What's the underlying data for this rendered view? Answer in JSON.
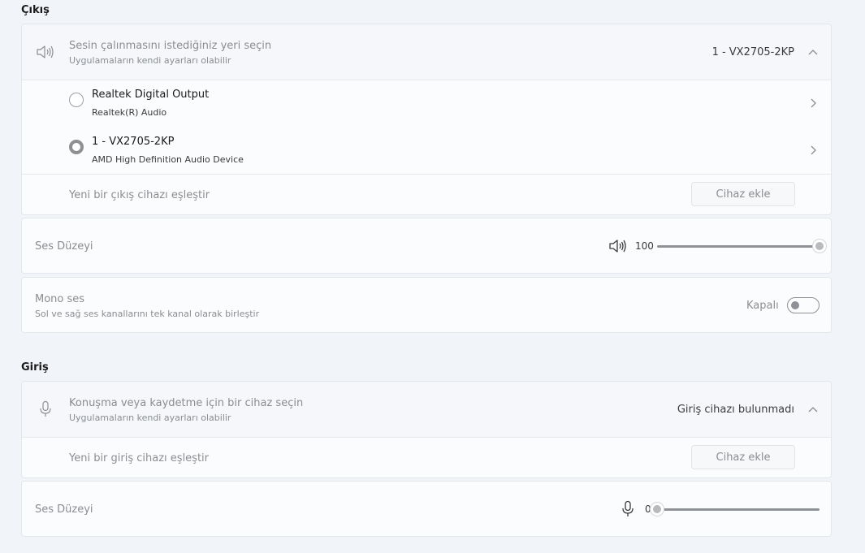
{
  "output": {
    "section_title": "Çıkış",
    "device_picker": {
      "title": "Sesin çalınmasını istediğiniz yeri seçin",
      "subtitle": "Uygulamaların kendi ayarları olabilir",
      "selected": "1 - VX2705-2KP",
      "icon": "speaker-icon"
    },
    "devices": [
      {
        "name": "Realtek Digital Output",
        "detail": "Realtek(R) Audio",
        "selected": false
      },
      {
        "name": "1 - VX2705-2KP",
        "detail": "AMD High Definition Audio Device",
        "selected": true
      }
    ],
    "pair": {
      "label": "Yeni bir çıkış cihazı eşleştir",
      "button": "Cihaz ekle"
    },
    "volume": {
      "label": "Ses Düzeyi",
      "value": "100",
      "level": 100,
      "icon": "speaker-icon"
    },
    "mono": {
      "title": "Mono ses",
      "subtitle": "Sol ve sağ ses kanallarını tek kanal olarak birleştir",
      "state": "Kapalı",
      "on": false
    }
  },
  "input": {
    "section_title": "Giriş",
    "device_picker": {
      "title": "Konuşma veya kaydetme için bir cihaz seçin",
      "subtitle": "Uygulamaların kendi ayarları olabilir",
      "selected": "Giriş cihazı bulunmadı",
      "icon": "microphone-icon"
    },
    "pair": {
      "label": "Yeni bir giriş cihazı eşleştir",
      "button": "Cihaz ekle"
    },
    "volume": {
      "label": "Ses Düzeyi",
      "value": "0",
      "level": 0,
      "icon": "microphone-icon"
    }
  }
}
